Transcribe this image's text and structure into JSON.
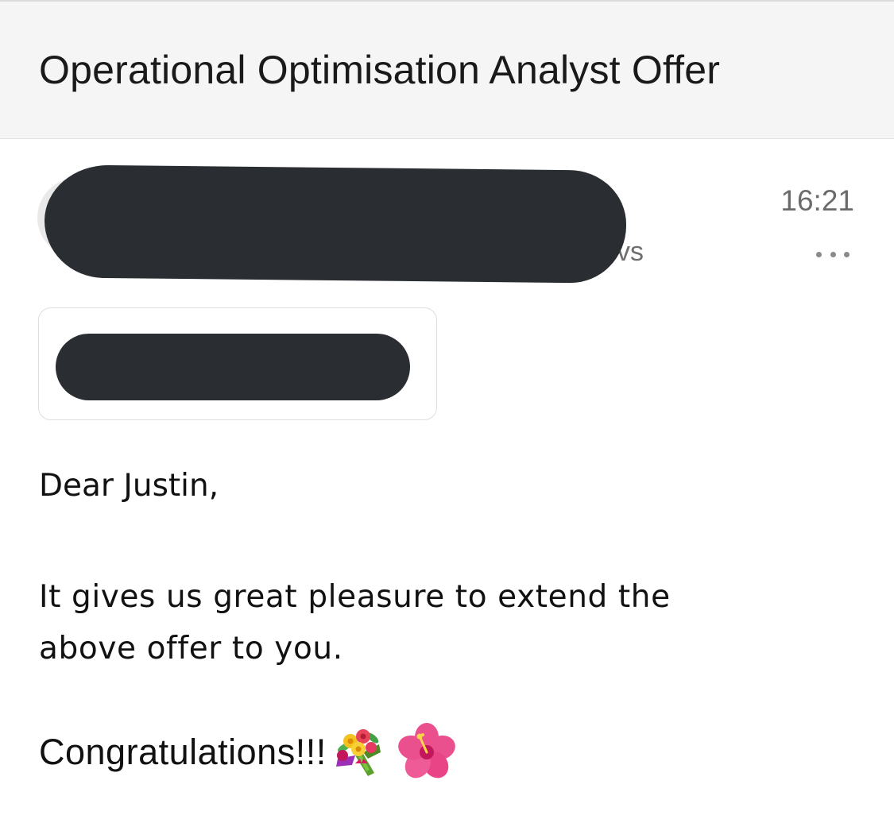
{
  "email": {
    "subject": "Operational Optimisation Analyst Offer",
    "sender_suffix": "vs",
    "time": "16:21",
    "more_icon": "ellipsis-icon",
    "greeting": "Dear Justin,",
    "paragraph_line1": "It gives us great pleasure to extend the",
    "paragraph_line2": "above offer to you.",
    "closing": "Congratulations!!!",
    "emoji_1": "bouquet-icon",
    "emoji_2": "hibiscus-icon"
  },
  "colors": {
    "header_bg": "#f5f5f5",
    "redaction": "#2a2e33",
    "muted_text": "#6b6b6b"
  }
}
